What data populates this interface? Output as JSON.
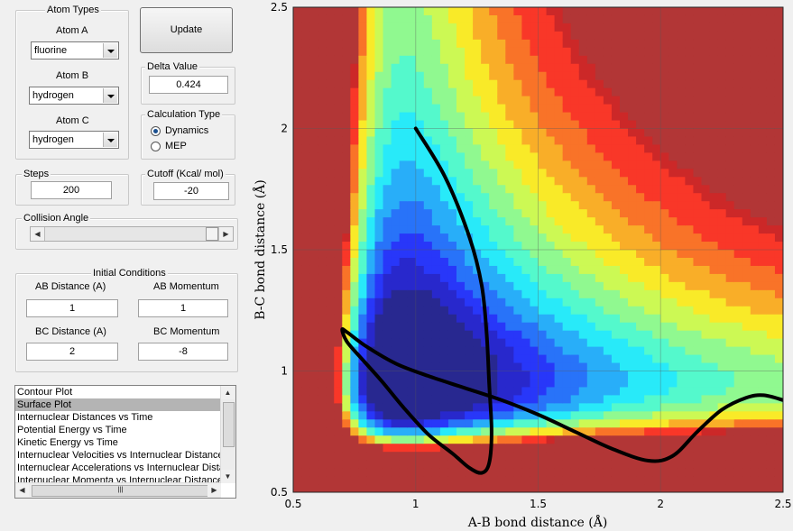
{
  "atom_types": {
    "title": "Atom Types",
    "atom_a": {
      "label": "Atom A",
      "value": "fluorine"
    },
    "atom_b": {
      "label": "Atom B",
      "value": "hydrogen"
    },
    "atom_c": {
      "label": "Atom C",
      "value": "hydrogen"
    }
  },
  "update_label": "Update",
  "delta": {
    "title": "Delta Value",
    "value": "0.424"
  },
  "calc_type": {
    "title": "Calculation Type",
    "options": [
      "Dynamics",
      "MEP"
    ],
    "selected": "Dynamics"
  },
  "steps": {
    "title": "Steps",
    "value": "200"
  },
  "cutoff": {
    "title": "Cutoff (Kcal/ mol)",
    "value": "-20"
  },
  "collision_angle": {
    "title": "Collision Angle"
  },
  "initial": {
    "title": "Initial Conditions",
    "ab_distance": {
      "label": "AB Distance (A)",
      "value": "1"
    },
    "ab_momentum": {
      "label": "AB Momentum",
      "value": "1"
    },
    "bc_distance": {
      "label": "BC Distance (A)",
      "value": "2"
    },
    "bc_momentum": {
      "label": "BC Momentum",
      "value": "-8"
    }
  },
  "plot_list": {
    "items": [
      "Contour Plot",
      "Surface Plot",
      "Internuclear Distances vs Time",
      "Potential Energy vs Time",
      "Kinetic Energy vs Time",
      "Internuclear Velocities vs Internuclear Distance",
      "Internuclear Accelerations vs Internuclear Distance",
      "Internuclear Momenta vs Internuclear Distance"
    ],
    "selected": 1
  },
  "colors": {
    "bg": "#f0f0f0",
    "trajectory": "#000000"
  },
  "chart_data": {
    "type": "heatmap",
    "title": "",
    "xlabel": "A-B bond distance (Å)",
    "ylabel": "B-C bond distance (Å)",
    "xlim": [
      0.5,
      2.5
    ],
    "ylim": [
      0.5,
      2.5
    ],
    "xticks": [
      "0.5",
      "1",
      "1.5",
      "2",
      "2.5"
    ],
    "yticks": [
      "0.5",
      "1",
      "1.5",
      "2",
      "2.5"
    ],
    "grid": true,
    "trajectory": {
      "x": [
        1.0,
        1.12,
        1.22,
        1.27,
        1.29,
        1.3,
        1.31,
        1.3,
        1.27,
        1.22,
        1.15,
        1.05,
        0.95,
        0.86,
        0.78,
        0.72,
        0.7,
        0.72,
        0.8,
        0.92,
        1.05,
        1.2,
        1.35,
        1.5,
        1.65,
        1.8,
        1.95,
        2.05,
        2.15,
        2.25,
        2.35,
        2.42,
        2.5
      ],
      "y": [
        2.0,
        1.8,
        1.55,
        1.35,
        1.15,
        0.95,
        0.75,
        0.62,
        0.58,
        0.6,
        0.66,
        0.74,
        0.85,
        0.96,
        1.05,
        1.12,
        1.17,
        1.16,
        1.1,
        1.03,
        0.98,
        0.93,
        0.88,
        0.82,
        0.75,
        0.68,
        0.63,
        0.65,
        0.75,
        0.84,
        0.89,
        0.9,
        0.88
      ]
    },
    "surface": {
      "type": "LEPS potential energy contour (filled)",
      "valley_ab": 0.95,
      "valley_bc": 0.95,
      "colormap": "jet"
    }
  }
}
